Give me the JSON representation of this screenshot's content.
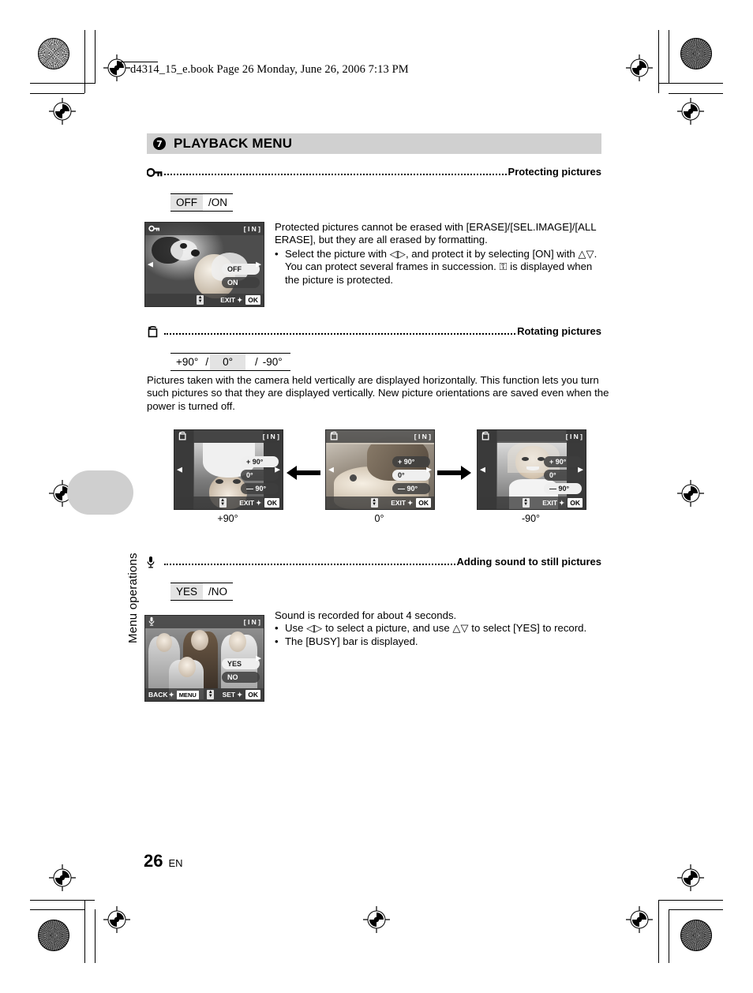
{
  "book_header": "d4314_15_e.book  Page 26  Monday, June 26, 2006  7:13 PM",
  "side_tab_label": "Menu operations",
  "section": {
    "number": "7",
    "title": "PLAYBACK MENU"
  },
  "sections": [
    {
      "icon": "key-icon",
      "name": "Protecting pictures",
      "options": [
        {
          "label": "OFF",
          "selected": true
        },
        {
          "label": "/ON",
          "selected": false
        }
      ],
      "body_lines": [
        "Protected pictures cannot be erased with [ERASE]/[SEL.IMAGE]/[ALL",
        "ERASE], but they are all erased by formatting."
      ],
      "bullets": [
        "Select the picture with ◁▷, and protect it by selecting [ON] with △▽. You can protect several frames in succession. ⚿ is displayed when the picture is protected."
      ],
      "lcd": {
        "top_left_icon": "key-icon",
        "top_right": "[ I N ]",
        "menu_items": [
          {
            "label": "OFF",
            "selected": true
          },
          {
            "label": "ON",
            "selected": false
          }
        ],
        "bottom_right_label": "EXIT",
        "bottom_right_key": "OK",
        "bottom_sep": "✦"
      }
    },
    {
      "icon": "rotate-icon",
      "name": "Rotating pictures",
      "options": [
        {
          "label": "+90°",
          "selected": false
        },
        {
          "label": "/",
          "selected": false
        },
        {
          "label": "0°",
          "selected": true
        },
        {
          "label": "/",
          "selected": false
        },
        {
          "label": "-90°",
          "selected": false
        }
      ],
      "body_lines": [
        "Pictures taken with the camera held vertically are displayed horizontally. This function",
        "lets you turn such pictures so that they are displayed vertically. New picture orientations",
        "are saved even when the power is turned off."
      ],
      "figures": [
        {
          "caption": "+90°",
          "top_right": "[ I N ]",
          "menu_items": [
            {
              "label": "+ 90°",
              "selected": true
            },
            {
              "label": "0°",
              "selected": false
            },
            {
              "label": "— 90°",
              "selected": false
            }
          ],
          "bottom_right_label": "EXIT",
          "bottom_right_key": "OK"
        },
        {
          "caption": "0°",
          "top_right": "[ I N ]",
          "menu_items": [
            {
              "label": "+ 90°",
              "selected": false
            },
            {
              "label": "0°",
              "selected": true
            },
            {
              "label": "— 90°",
              "selected": false
            }
          ],
          "bottom_right_label": "EXIT",
          "bottom_right_key": "OK"
        },
        {
          "caption": "-90°",
          "top_right": "[ I N ]",
          "menu_items": [
            {
              "label": "+ 90°",
              "selected": false
            },
            {
              "label": "0°",
              "selected": false
            },
            {
              "label": "— 90°",
              "selected": true
            }
          ],
          "bottom_right_label": "EXIT",
          "bottom_right_key": "OK"
        }
      ]
    },
    {
      "icon": "microphone-icon",
      "name": "Adding sound to still pictures",
      "options": [
        {
          "label": "YES",
          "selected": true
        },
        {
          "label": "/NO",
          "selected": false
        }
      ],
      "body_lines": [
        "Sound is recorded for about 4 seconds."
      ],
      "bullets": [
        "Use ◁▷ to select a picture, and use △▽ to select [YES] to record.",
        "The [BUSY] bar is displayed."
      ],
      "lcd": {
        "top_left_icon": "microphone-icon",
        "top_right": "[ I N ]",
        "menu_items": [
          {
            "label": "YES",
            "selected": true
          },
          {
            "label": "NO",
            "selected": false
          }
        ],
        "bottom_left_label": "BACK",
        "bottom_left_key": "MENU",
        "bottom_right_label": "SET",
        "bottom_right_key": "OK"
      }
    }
  ],
  "footer": {
    "page_number": "26",
    "language": "EN"
  }
}
